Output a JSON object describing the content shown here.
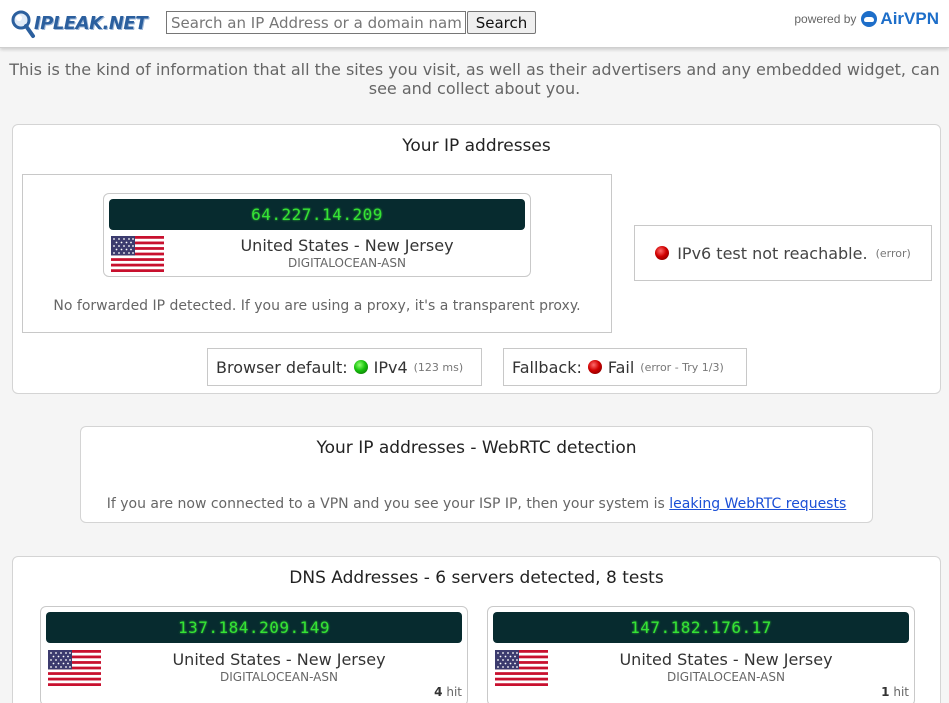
{
  "header": {
    "logo_text": "IPLEAK.NET",
    "search_placeholder": "Search an IP Address or a domain name",
    "search_button": "Search",
    "powered_by": "powered by",
    "brand": "AirVPN"
  },
  "intro": "This is the kind of information that all the sites you visit, as well as their advertisers and any embedded widget, can see and collect about you.",
  "ip_section": {
    "title": "Your IP addresses",
    "ipv4": {
      "ip": "64.227.14.209",
      "location": "United States - New Jersey",
      "asn": "DIGITALOCEAN-ASN"
    },
    "forwarded_note": "No forwarded IP detected. If you are using a proxy, it's a transparent proxy.",
    "ipv6": {
      "message": "IPv6 test not reachable.",
      "note": "(error)"
    },
    "browser_default": {
      "label": "Browser default:",
      "value": "IPv4",
      "note": "(123 ms)"
    },
    "fallback": {
      "label": "Fallback:",
      "value": "Fail",
      "note": "(error - Try 1/3)"
    }
  },
  "webrtc_section": {
    "title": "Your IP addresses - WebRTC detection",
    "text": "If you are now connected to a VPN and you see your ISP IP, then your system is",
    "link": "leaking WebRTC requests"
  },
  "dns_section": {
    "title": "DNS Addresses - 6 servers detected, 8 tests",
    "servers": [
      {
        "ip": "137.184.209.149",
        "location": "United States - New Jersey",
        "asn": "DIGITALOCEAN-ASN",
        "hits": "4",
        "hit_label": "hit"
      },
      {
        "ip": "147.182.176.17",
        "location": "United States - New Jersey",
        "asn": "DIGITALOCEAN-ASN",
        "hits": "1",
        "hit_label": "hit"
      }
    ]
  },
  "colors": {
    "ip_bar": "#072b2f",
    "ip_text": "#35e335",
    "status_ok": "#17c20c",
    "status_error": "#d00000",
    "link": "#1a4fd6"
  },
  "icons": [
    "us-flag-icon",
    "green-status-icon",
    "red-status-icon",
    "airvpn-logo-icon",
    "ipleak-magnifier-icon"
  ]
}
